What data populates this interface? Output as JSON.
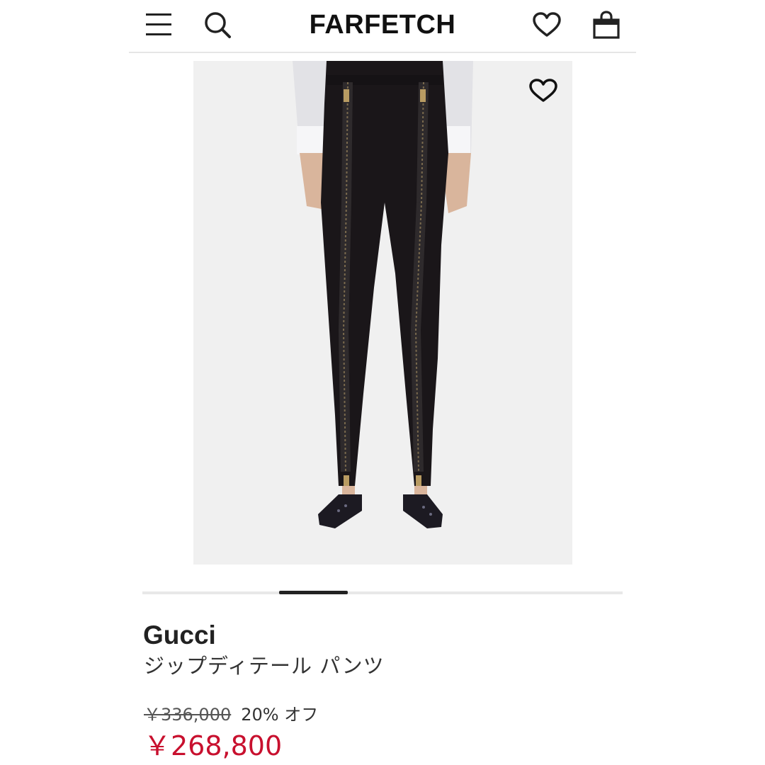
{
  "header": {
    "logo": "FARFETCH",
    "menu_icon": "hamburger-icon",
    "search_icon": "search-icon",
    "wishlist_icon": "heart-icon",
    "bag_icon": "shopping-bag-icon"
  },
  "gallery": {
    "favorite_icon": "heart-outline-icon",
    "image_alt": "Gucci zip-detail trousers worn by model",
    "slide_progress": 0.25
  },
  "product": {
    "brand": "Gucci",
    "name": "ジップディテール パンツ",
    "original_price": "￥336,000",
    "discount": "20% オフ",
    "sale_price": "￥268,800"
  },
  "colors": {
    "sale_price": "#c8102e",
    "text": "#222222",
    "photo_background": "#f0f0f0"
  }
}
